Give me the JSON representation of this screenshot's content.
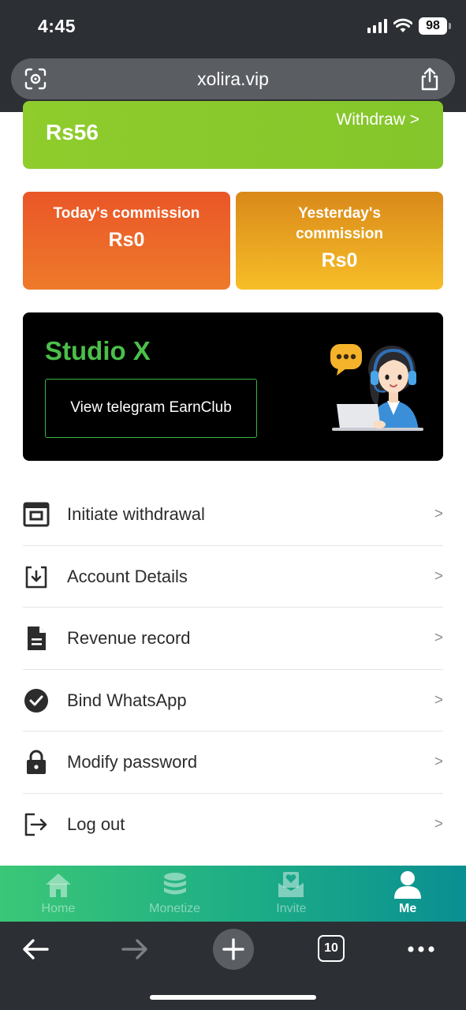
{
  "status_bar": {
    "time": "4:45",
    "battery": "98"
  },
  "browser": {
    "url": "xolira.vip",
    "tab_count": "10"
  },
  "balance": {
    "amount": "Rs56",
    "withdraw_label": "Withdraw >"
  },
  "commissions": {
    "today_label": "Today's commission",
    "today_value": "Rs0",
    "yesterday_label": "Yesterday's commission",
    "yesterday_value": "Rs0"
  },
  "studio": {
    "title": "Studio X",
    "button_label": "View telegram EarnClub"
  },
  "menu": [
    {
      "label": "Initiate withdrawal",
      "icon": "wallet-icon",
      "arrow": ">"
    },
    {
      "label": "Account Details",
      "icon": "download-box-icon",
      "arrow": ">"
    },
    {
      "label": "Revenue record",
      "icon": "document-icon",
      "arrow": ">"
    },
    {
      "label": "Bind WhatsApp",
      "icon": "check-circle-icon",
      "arrow": ">"
    },
    {
      "label": "Modify password",
      "icon": "lock-icon",
      "arrow": ">"
    },
    {
      "label": "Log out",
      "icon": "logout-icon",
      "arrow": ">"
    }
  ],
  "bottom_nav": {
    "items": [
      {
        "label": "Home",
        "icon": "home-icon",
        "active": false
      },
      {
        "label": "Monetize",
        "icon": "coins-stack-icon",
        "active": false
      },
      {
        "label": "Invite",
        "icon": "invite-envelope-icon",
        "active": false
      },
      {
        "label": "Me",
        "icon": "user-icon",
        "active": true
      }
    ]
  },
  "colors": {
    "balance_card": "#8fcc2c",
    "today_card": "#ea5628",
    "yesterday_card": "#f7be28",
    "studio_green": "#4bbf4a",
    "nav_gradient_start": "#3bc777",
    "nav_gradient_end": "#0a8f92"
  }
}
